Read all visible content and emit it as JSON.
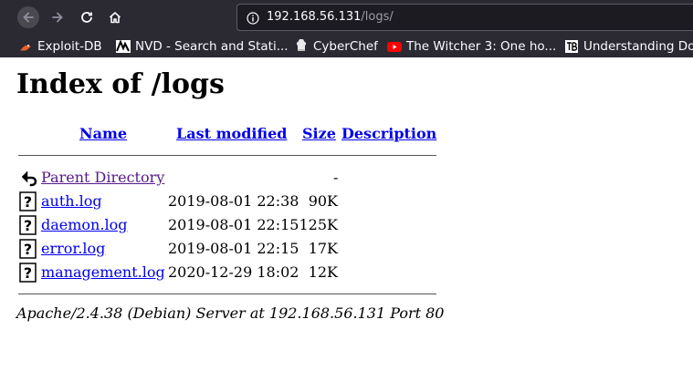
{
  "browser": {
    "url_host": "192.168.56.131",
    "url_path": "/logs/",
    "bookmarks": [
      {
        "label": "Exploit-DB",
        "icon": "exploit-db-icon"
      },
      {
        "label": "NVD - Search and Stati...",
        "icon": "nvd-icon"
      },
      {
        "label": "CyberChef",
        "icon": "cyberchef-icon"
      },
      {
        "label": "The Witcher 3: One ho...",
        "icon": "youtube-icon"
      },
      {
        "label": "Understanding Do",
        "icon": "tb-icon"
      }
    ]
  },
  "page": {
    "title": "Index of /logs",
    "columns": {
      "name": "Name",
      "last_modified": "Last modified",
      "size": "Size",
      "description": "Description"
    },
    "parent": {
      "name": "Parent Directory",
      "size": "-"
    },
    "rows": [
      {
        "name": "auth.log",
        "modified": "2019-08-01 22:38",
        "size": "90K"
      },
      {
        "name": "daemon.log",
        "modified": "2019-08-01 22:15",
        "size": "125K"
      },
      {
        "name": "error.log",
        "modified": "2019-08-01 22:15",
        "size": "17K"
      },
      {
        "name": "management.log",
        "modified": "2020-12-29 18:02",
        "size": "12K"
      }
    ],
    "footer": "Apache/2.4.38 (Debian) Server at 192.168.56.131 Port 80"
  }
}
